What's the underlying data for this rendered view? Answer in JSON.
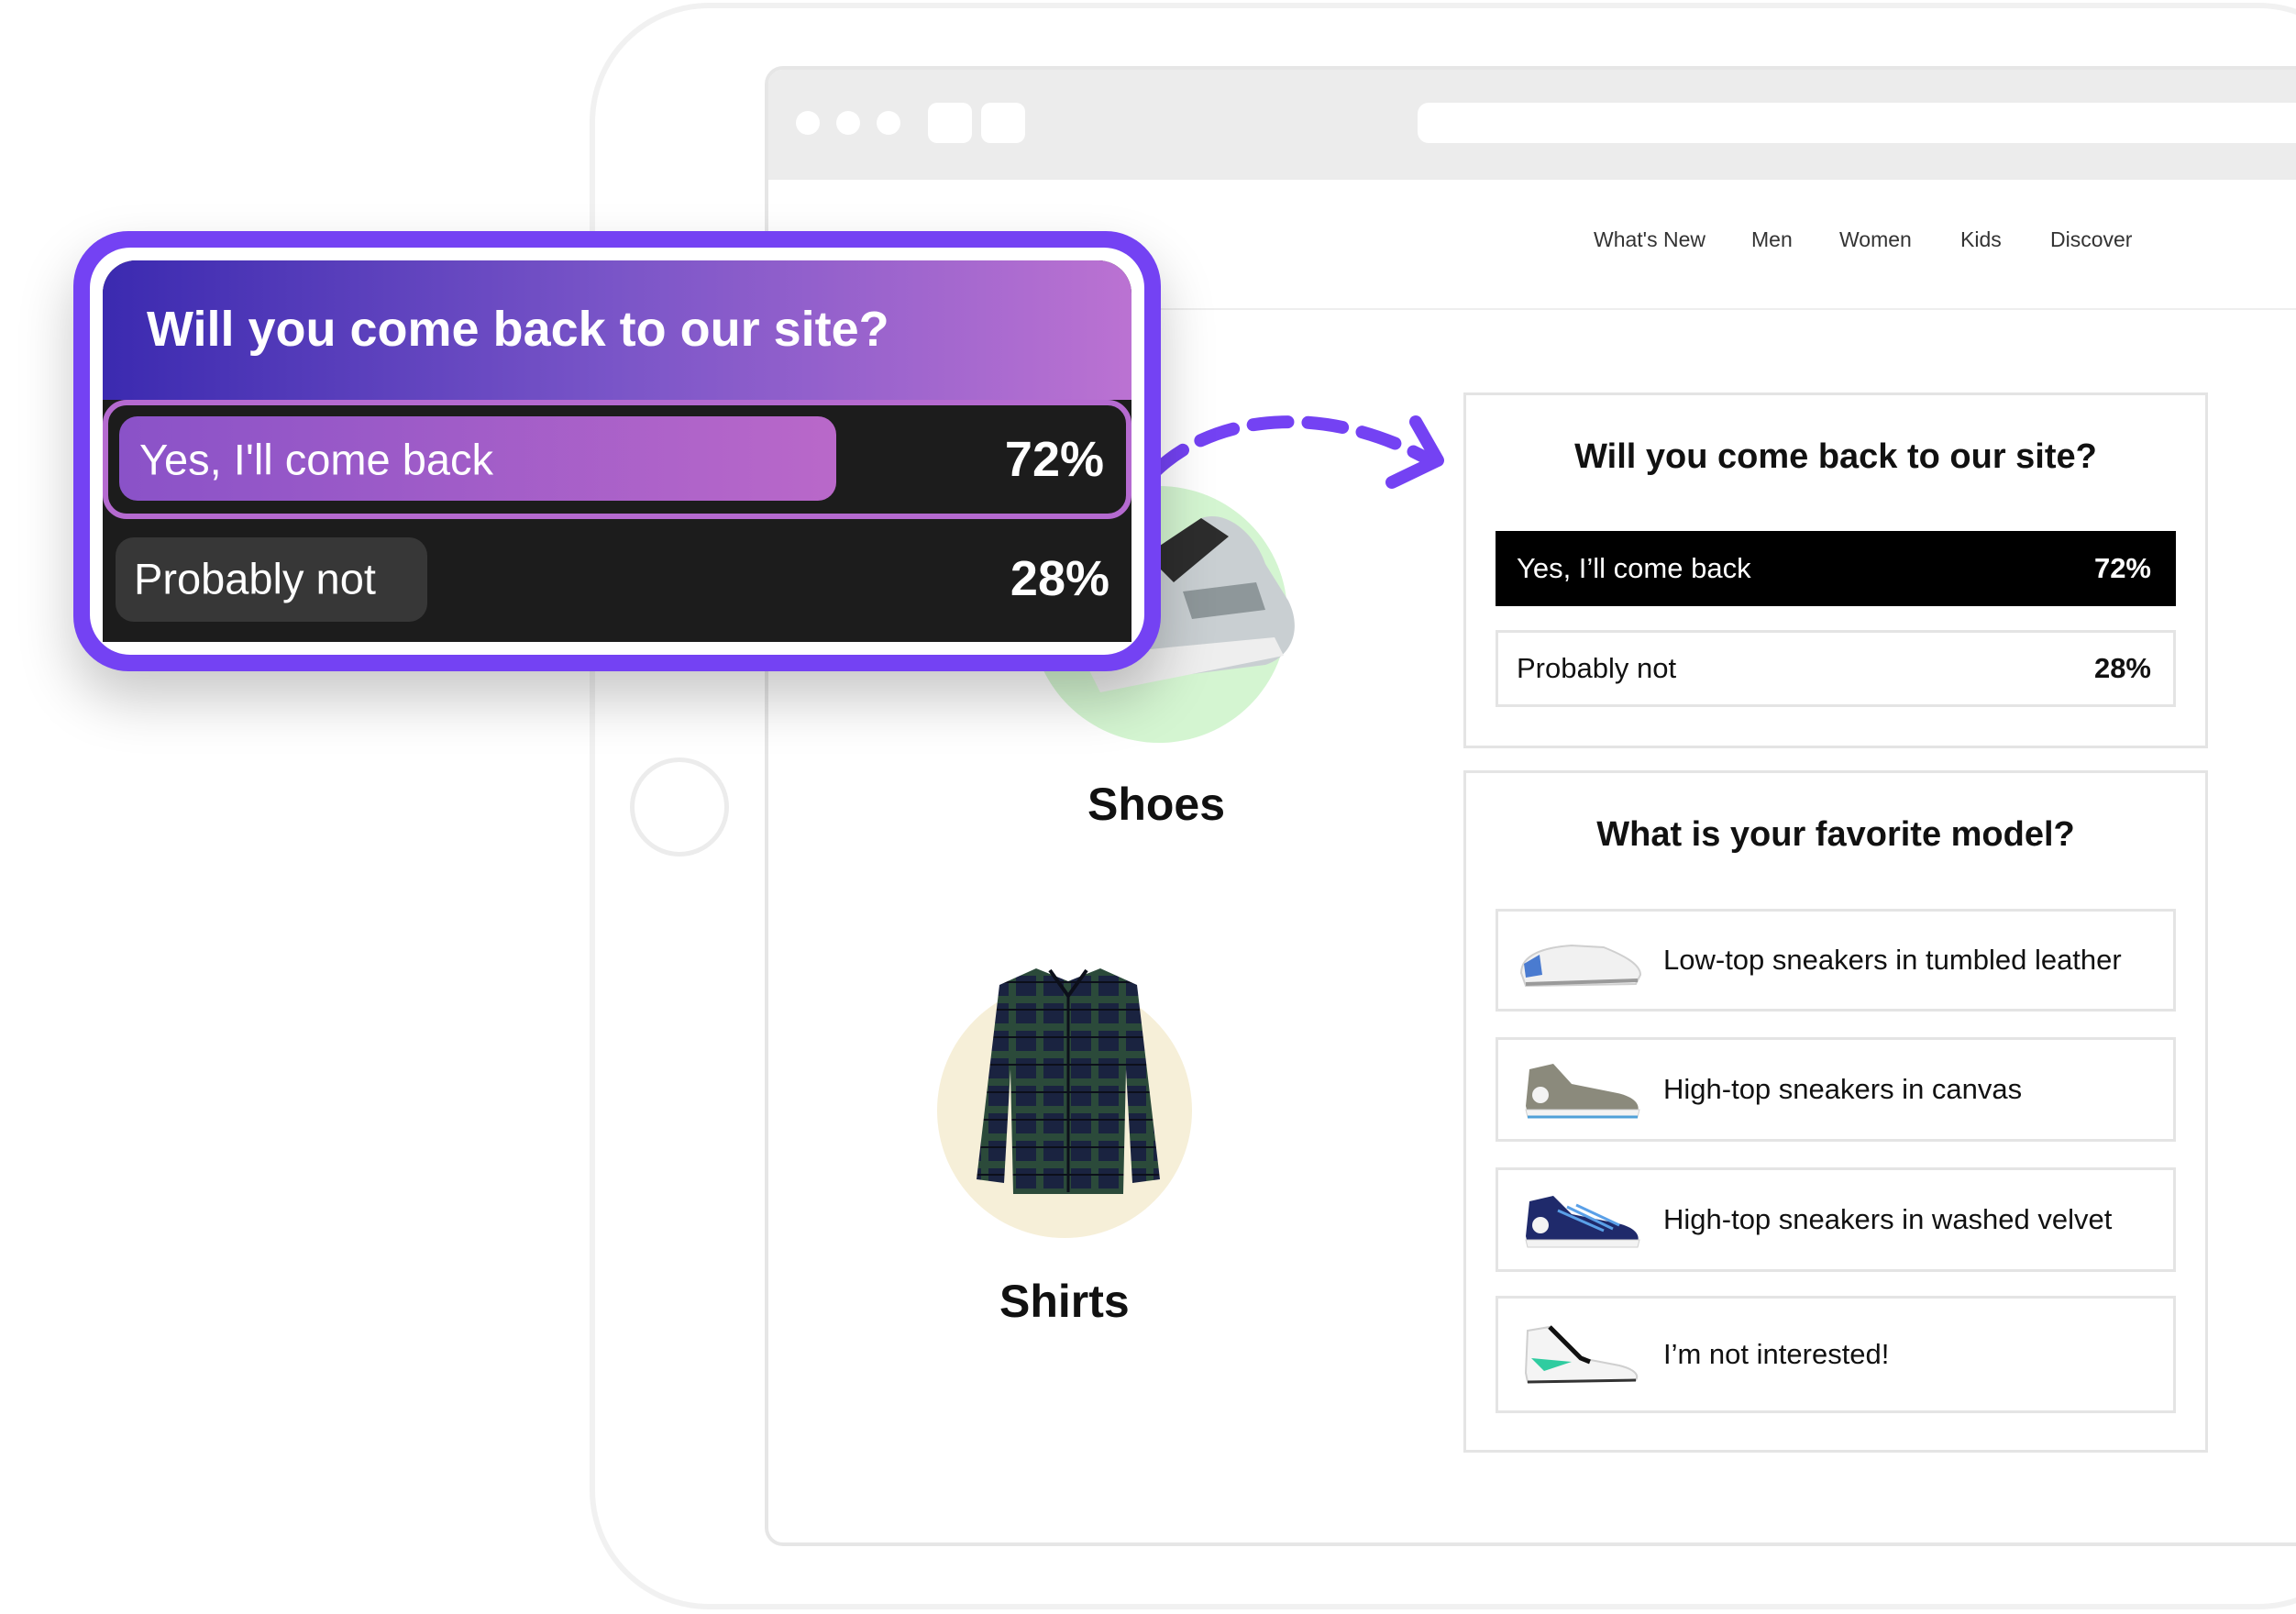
{
  "nav": {
    "items": [
      "What's New",
      "Men",
      "Women",
      "Kids",
      "Discover"
    ]
  },
  "categories": [
    {
      "label": "Shoes",
      "icon": "sneaker-image",
      "circle_color": "#d4f5d1"
    },
    {
      "label": "Shirts",
      "icon": "plaid-shirt-image",
      "circle_color": "#f6efd8"
    }
  ],
  "poll_widget": {
    "title": "Will you come back to our site?",
    "options": [
      {
        "label": "Yes, I'll come back",
        "percent": "72%",
        "share": 0.72,
        "selected": true
      },
      {
        "label": "Probably not",
        "percent": "28%",
        "share": 0.28,
        "selected": false
      }
    ],
    "accent": "#7442f3"
  },
  "poll_card": {
    "title": "Will you come back to our site?",
    "options": [
      {
        "label": "Yes, I’ll come back",
        "percent": "72%",
        "selected": true
      },
      {
        "label": "Probably not",
        "percent": "28%",
        "selected": false
      }
    ]
  },
  "model_card": {
    "title": "What is your favorite model?",
    "options": [
      {
        "label": "Low-top sneakers in tumbled leather",
        "icon": "low-top-sneaker-icon"
      },
      {
        "label": "High-top sneakers in canvas",
        "icon": "grey-high-top-sneaker-icon"
      },
      {
        "label": "High-top sneakers in washed velvet",
        "icon": "navy-high-top-sneaker-icon"
      },
      {
        "label": "I’m not interested!",
        "icon": "white-green-sneaker-icon"
      }
    ]
  }
}
